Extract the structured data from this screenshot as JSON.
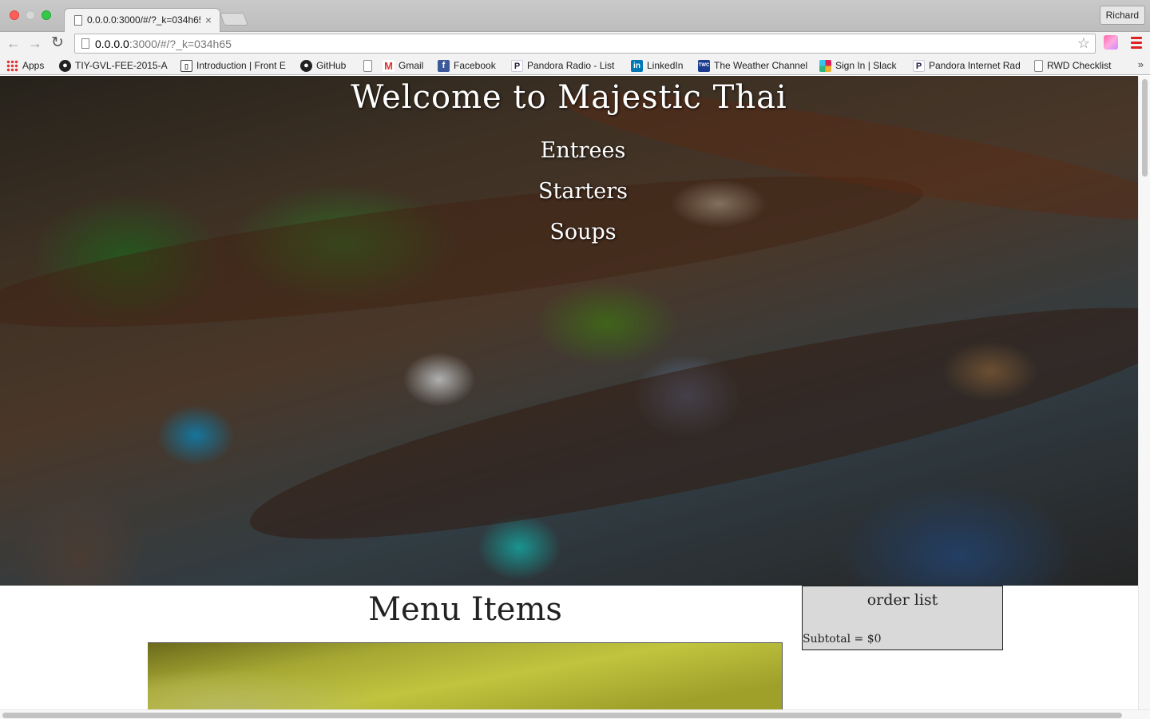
{
  "browser": {
    "tab_title": "0.0.0.0:3000/#/?_k=034h65",
    "tab_close": "×",
    "user_button": "Richard",
    "back_glyph": "←",
    "forward_glyph": "→",
    "reload_glyph": "↻",
    "url_host": "0.0.0.0",
    "url_rest": ":3000/#/?_k=034h65",
    "star_glyph": "☆",
    "overflow_glyph": "»",
    "bookmarks": [
      {
        "label": "Apps",
        "icon": "apps-grid-icon"
      },
      {
        "label": "TIY-GVL-FEE-2015-A",
        "icon": "github-icon"
      },
      {
        "label": "Introduction | Front E",
        "icon": "book-icon"
      },
      {
        "label": "GitHub",
        "icon": "github-icon"
      },
      {
        "label": "",
        "icon": "page-icon"
      },
      {
        "label": "Gmail",
        "icon": "gmail-icon"
      },
      {
        "label": "Facebook",
        "icon": "facebook-icon"
      },
      {
        "label": "Pandora Radio - List",
        "icon": "pandora-icon"
      },
      {
        "label": "LinkedIn",
        "icon": "linkedin-icon"
      },
      {
        "label": "The Weather Channel",
        "icon": "weather-channel-icon"
      },
      {
        "label": "Sign In | Slack",
        "icon": "slack-icon"
      },
      {
        "label": "Pandora Internet Rad",
        "icon": "pandora-icon"
      },
      {
        "label": "RWD Checklist",
        "icon": "page-icon"
      }
    ],
    "icon_glyphs": {
      "github": "●",
      "book": "▯",
      "gmail": "M",
      "facebook": "f",
      "pandora": "P",
      "linkedin": "in",
      "weather": "TWC"
    }
  },
  "page": {
    "hero_title": "Welcome to Majestic Thai",
    "nav": {
      "entrees": "Entrees",
      "starters": "Starters",
      "soups": "Soups"
    },
    "menu_heading": "Menu Items",
    "order_list": {
      "title": "order list",
      "subtotal": "Subtotal = $0"
    }
  }
}
